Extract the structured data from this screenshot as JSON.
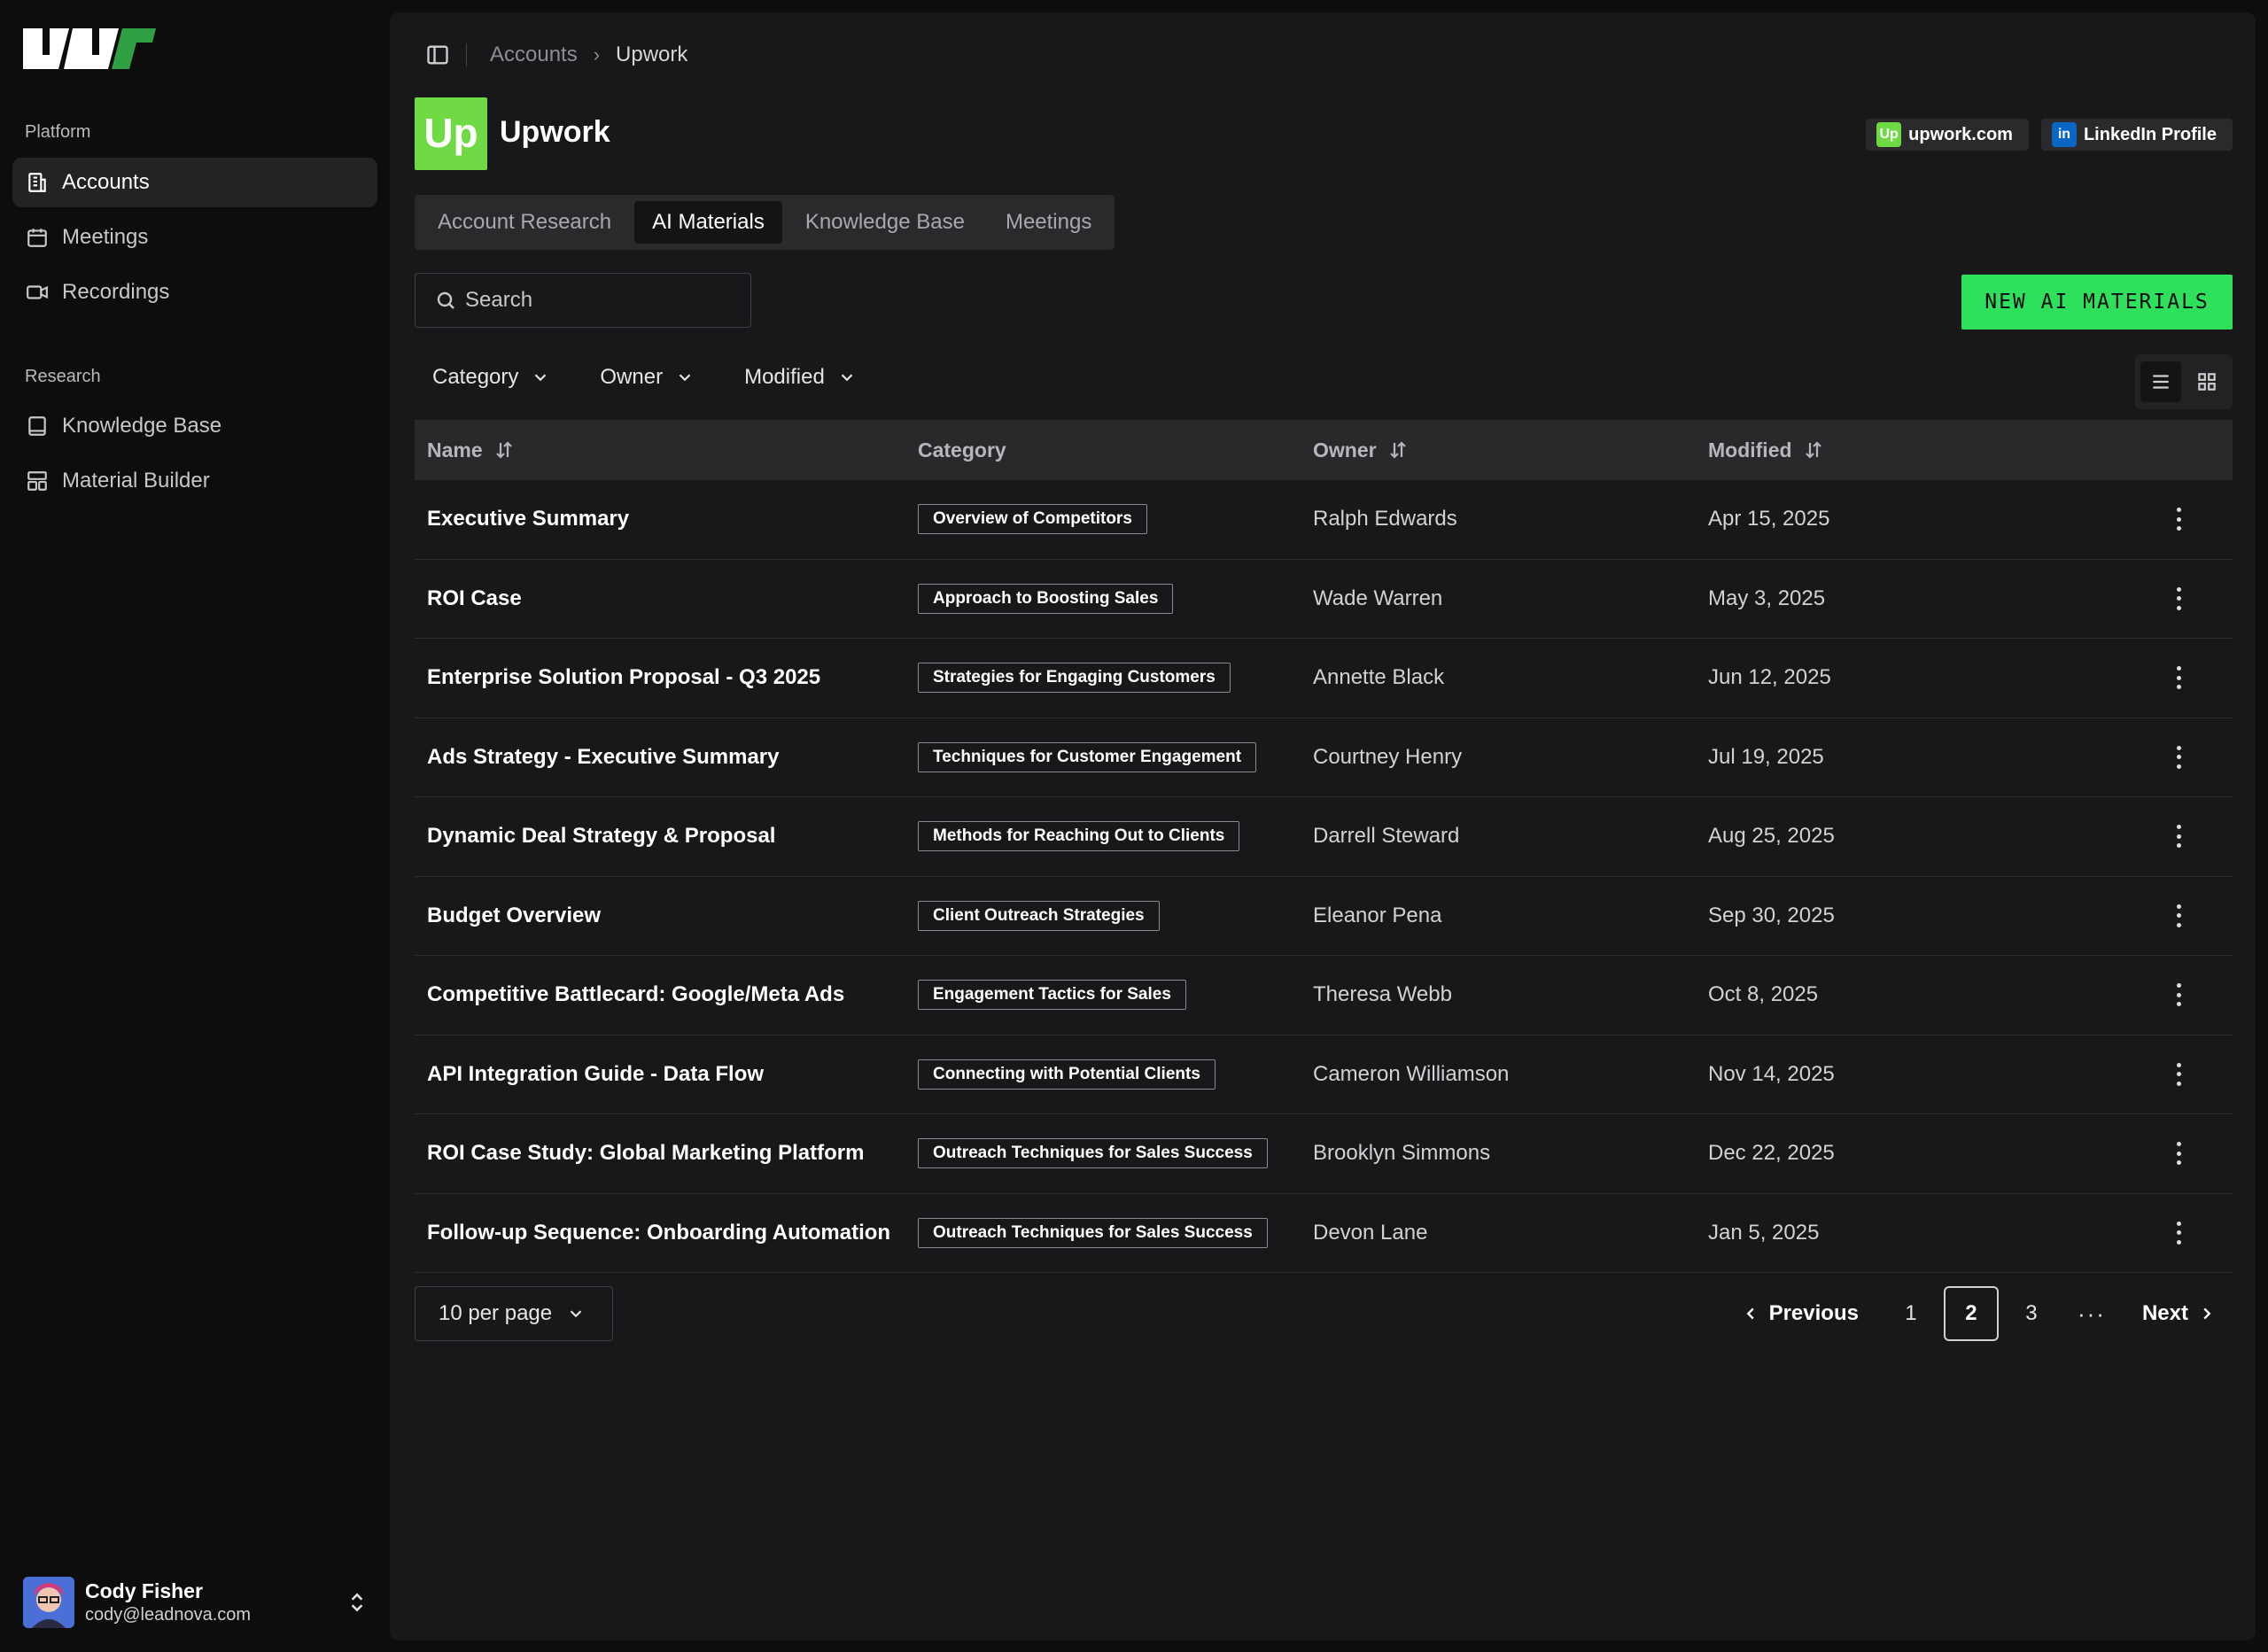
{
  "sidebar": {
    "platform_label": "Platform",
    "research_label": "Research",
    "items": [
      {
        "label": "Accounts",
        "icon": "building-icon",
        "active": true
      },
      {
        "label": "Meetings",
        "icon": "calendar-icon",
        "active": false
      },
      {
        "label": "Recordings",
        "icon": "video-icon",
        "active": false
      },
      {
        "label": "Knowledge Base",
        "icon": "book-icon",
        "active": false
      },
      {
        "label": "Material Builder",
        "icon": "layout-icon",
        "active": false
      }
    ],
    "user": {
      "name": "Cody Fisher",
      "email": "cody@leadnova.com"
    }
  },
  "breadcrumb": {
    "parent": "Accounts",
    "current": "Upwork"
  },
  "company": {
    "name": "Upwork",
    "logo_text": "Up",
    "links": [
      {
        "label": "upwork.com",
        "badge": "Up",
        "color": "#6fda44"
      },
      {
        "label": "LinkedIn Profile",
        "badge": "in",
        "color": "#0a66c2"
      }
    ]
  },
  "tabs": [
    "Account Research",
    "AI Materials",
    "Knowledge Base",
    "Meetings"
  ],
  "active_tab": "AI Materials",
  "search": {
    "placeholder": "Search"
  },
  "new_button": "NEW AI MATERIALS",
  "filters": [
    "Category",
    "Owner",
    "Modified"
  ],
  "table": {
    "headers": {
      "name": "Name",
      "category": "Category",
      "owner": "Owner",
      "modified": "Modified"
    },
    "rows": [
      {
        "name": "Executive Summary",
        "category": "Overview of Competitors",
        "owner": "Ralph Edwards",
        "modified": "Apr 15, 2025"
      },
      {
        "name": "ROI Case",
        "category": "Approach to Boosting Sales",
        "owner": "Wade Warren",
        "modified": "May 3, 2025"
      },
      {
        "name": "Enterprise Solution Proposal - Q3 2025",
        "category": "Strategies for Engaging Customers",
        "owner": "Annette Black",
        "modified": "Jun 12, 2025"
      },
      {
        "name": "Ads Strategy - Executive Summary",
        "category": "Techniques for Customer Engagement",
        "owner": "Courtney Henry",
        "modified": "Jul 19, 2025"
      },
      {
        "name": "Dynamic Deal Strategy & Proposal",
        "category": "Methods for Reaching Out to Clients",
        "owner": "Darrell Steward",
        "modified": "Aug 25, 2025"
      },
      {
        "name": "Budget Overview",
        "category": "Client Outreach Strategies",
        "owner": "Eleanor Pena",
        "modified": "Sep 30, 2025"
      },
      {
        "name": "Competitive Battlecard: Google/Meta Ads",
        "category": "Engagement Tactics for Sales",
        "owner": "Theresa Webb",
        "modified": "Oct 8, 2025"
      },
      {
        "name": "API Integration Guide - Data Flow",
        "category": "Connecting with Potential Clients",
        "owner": "Cameron Williamson",
        "modified": "Nov 14, 2025"
      },
      {
        "name": "ROI Case Study: Global Marketing Platform",
        "category": "Outreach Techniques for Sales Success",
        "owner": "Brooklyn Simmons",
        "modified": "Dec 22, 2025"
      },
      {
        "name": "Follow-up Sequence: Onboarding Automation",
        "category": "Outreach Techniques for Sales Success",
        "owner": "Devon Lane",
        "modified": "Jan 5, 2025"
      }
    ]
  },
  "pagination": {
    "per_page": "10 per page",
    "previous": "Previous",
    "next": "Next",
    "pages": [
      "1",
      "2",
      "3"
    ],
    "current": "2",
    "ellipsis": "···"
  },
  "colors": {
    "accent": "#2ee05c",
    "upwork_green": "#6fda44",
    "linkedin_blue": "#0a66c2"
  }
}
